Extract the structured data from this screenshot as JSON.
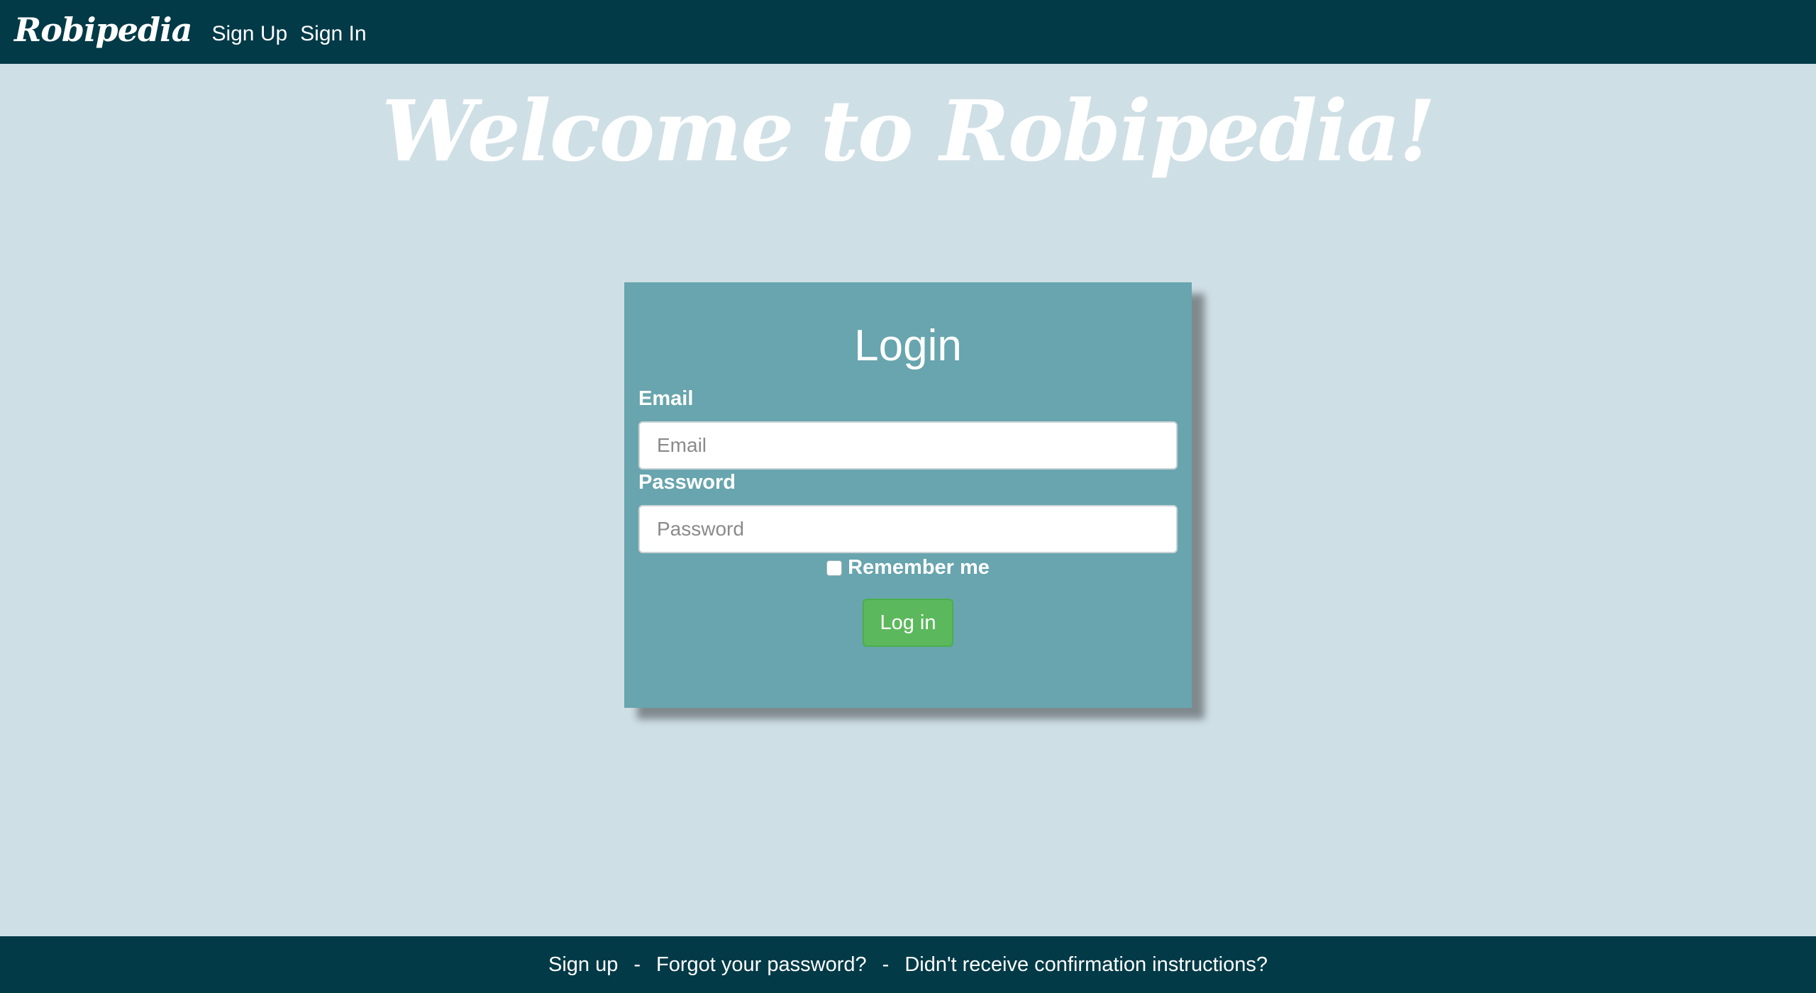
{
  "navbar": {
    "brand": "Robipedia",
    "links": [
      "Sign Up",
      "Sign In"
    ]
  },
  "welcome": {
    "title": "Welcome to Robipedia!"
  },
  "login": {
    "title": "Login",
    "email_label": "Email",
    "email_placeholder": "Email",
    "email_value": "",
    "password_label": "Password",
    "password_placeholder": "Password",
    "password_value": "",
    "remember_label": "Remember me",
    "remember_checked": false,
    "submit_label": "Log in"
  },
  "footer": {
    "links": [
      "Sign up",
      "Forgot your password?",
      "Didn't receive confirmation instructions?"
    ],
    "separator": "-"
  },
  "colors": {
    "navbar_bg": "#023a47",
    "page_bg": "#cfdfe6",
    "card_bg": "#68a5ae",
    "button_bg": "#5cb85c",
    "text": "#ffffff"
  }
}
